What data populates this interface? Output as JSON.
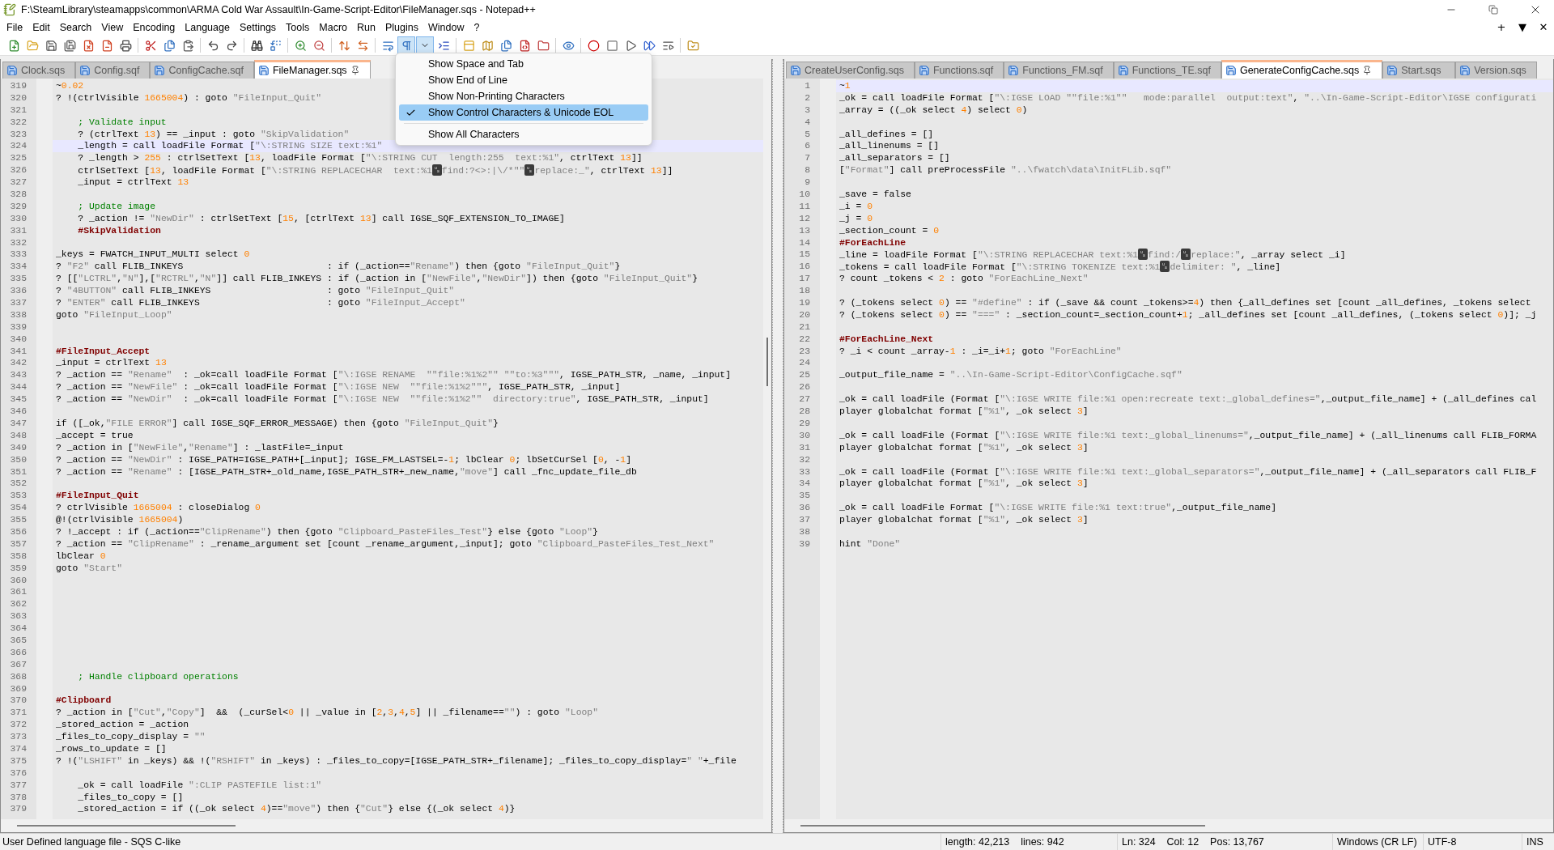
{
  "window": {
    "title": "F:\\SteamLibrary\\steamapps\\common\\ARMA Cold War Assault\\In-Game-Script-Editor\\FileManager.sqs - Notepad++"
  },
  "menu_bar": {
    "items": [
      "File",
      "Edit",
      "Search",
      "View",
      "Encoding",
      "Language",
      "Settings",
      "Tools",
      "Macro",
      "Run",
      "Plugins",
      "Window",
      "?"
    ],
    "doc_controls": [
      "+",
      "▼",
      "✕"
    ]
  },
  "toolbar": {
    "show_symbol_active": true
  },
  "dropdown": {
    "items": [
      {
        "kind": "item",
        "label": "Show Space and Tab",
        "checked": false,
        "selected": false
      },
      {
        "kind": "item",
        "label": "Show End of Line",
        "checked": false,
        "selected": false
      },
      {
        "kind": "item",
        "label": "Show Non-Printing Characters",
        "checked": false,
        "selected": false
      },
      {
        "kind": "item",
        "label": "Show Control Characters & Unicode EOL",
        "checked": true,
        "selected": true
      },
      {
        "kind": "separator"
      },
      {
        "kind": "item",
        "label": "Show All Characters",
        "checked": false,
        "selected": false
      }
    ]
  },
  "left_pane": {
    "tabs": [
      {
        "label": "Clock.sqs",
        "selected": false
      },
      {
        "label": "Config.sqf",
        "selected": false
      },
      {
        "label": "ConfigCache.sqf",
        "selected": false
      },
      {
        "label": "FileManager.sqs",
        "selected": true
      }
    ],
    "lines": [
      {
        "n": "319",
        "text": "~0.02",
        "current": false
      },
      {
        "n": "320",
        "text": "? !(ctrlVisible 1665004) : goto \"FileInput_Quit\"",
        "current": false
      },
      {
        "n": "321",
        "current": false
      },
      {
        "n": "322",
        "text": "    ; Validate input",
        "current": false
      },
      {
        "n": "323",
        "text": "    ? (ctrlText 13) == _input : goto \"SkipValidation\"",
        "current": false
      },
      {
        "n": "324",
        "text": "    _length = call loadFile Format [\"\\:STRING SIZE text:%1\"",
        "current": true
      },
      {
        "n": "325",
        "text": "    ? _length > 255 : ctrlSetText [13, loadFile Format [\"\\:STRING CUT  length:255  text:%1\", ctrlText 13]]",
        "current": false
      },
      {
        "n": "326",
        "text": "    ctrlSetText [13, loadFile Format [\"\\:STRING REPLACECHAR  text:%1␟find:?<>:|\\/*\"\"␟replace:_\", ctrlText 13]]",
        "current": false
      },
      {
        "n": "327",
        "text": "    _input = ctrlText 13",
        "current": false
      },
      {
        "n": "328",
        "current": false
      },
      {
        "n": "329",
        "text": "    ; Update image",
        "current": false
      },
      {
        "n": "330",
        "text": "    ? _action != \"NewDir\" : ctrlSetText [15, [ctrlText 13] call IGSE_SQF_EXTENSION_TO_IMAGE]",
        "current": false
      },
      {
        "n": "331",
        "text": "    #SkipValidation",
        "current": false
      },
      {
        "n": "332",
        "current": false
      },
      {
        "n": "333",
        "text": "_keys = FWATCH_INPUT_MULTI select 0",
        "current": false
      },
      {
        "n": "334",
        "text": "? \"F2\" call FLIB_INKEYS                          : if (_action==\"Rename\") then {goto \"FileInput_Quit\"}",
        "current": false
      },
      {
        "n": "335",
        "text": "? [[\"LCTRL\",\"N\"],[\"RCTRL\",\"N\"]] call FLIB_INKEYS : if (_action in [\"NewFile\",\"NewDir\"]) then {goto \"FileInput_Quit\"}",
        "current": false
      },
      {
        "n": "336",
        "text": "? \"4BUTTON\" call FLIB_INKEYS                     : goto \"FileInput_Quit\"",
        "current": false
      },
      {
        "n": "337",
        "text": "? \"ENTER\" call FLIB_INKEYS                       : goto \"FileInput_Accept\"",
        "current": false
      },
      {
        "n": "338",
        "text": "goto \"FileInput_Loop\"",
        "current": false
      },
      {
        "n": "339",
        "current": false
      },
      {
        "n": "340",
        "current": false
      },
      {
        "n": "341",
        "text": "#FileInput_Accept",
        "current": false
      },
      {
        "n": "342",
        "text": "_input = ctrlText 13",
        "current": false
      },
      {
        "n": "343",
        "text": "? _action == \"Rename\"  : _ok=call loadFile Format [\"\\:IGSE RENAME  \"\"file:%1%2\"\" \"\"to:%3\"\"\", IGSE_PATH_STR, _name, _input]",
        "current": false
      },
      {
        "n": "344",
        "text": "? _action == \"NewFile\" : _ok=call loadFile Format [\"\\:IGSE NEW  \"\"file:%1%2\"\"\", IGSE_PATH_STR, _input]",
        "current": false
      },
      {
        "n": "345",
        "text": "? _action == \"NewDir\"  : _ok=call loadFile Format [\"\\:IGSE NEW  \"\"file:%1%2\"\"  directory:true\", IGSE_PATH_STR, _input]",
        "current": false
      },
      {
        "n": "346",
        "current": false
      },
      {
        "n": "347",
        "text": "if ([_ok,\"FILE ERROR\"] call IGSE_SQF_ERROR_MESSAGE) then {goto \"FileInput_Quit\"}",
        "current": false
      },
      {
        "n": "348",
        "text": "_accept = true",
        "current": false
      },
      {
        "n": "349",
        "text": "? _action in [\"NewFile\",\"Rename\"] : _lastFile=_input",
        "current": false
      },
      {
        "n": "350",
        "text": "? _action == \"NewDir\" : IGSE_PATH=IGSE_PATH+[_input]; IGSE_FM_LASTSEL=-1; lbClear 0; lbSetCurSel [0, -1]",
        "current": false
      },
      {
        "n": "351",
        "text": "? _action == \"Rename\" : [IGSE_PATH_STR+_old_name,IGSE_PATH_STR+_new_name,\"move\"] call _fnc_update_file_db",
        "current": false
      },
      {
        "n": "352",
        "current": false
      },
      {
        "n": "353",
        "text": "#FileInput_Quit",
        "current": false
      },
      {
        "n": "354",
        "text": "? ctrlVisible 1665004 : closeDialog 0",
        "current": false
      },
      {
        "n": "355",
        "text": "@!(ctrlVisible 1665004)",
        "current": false
      },
      {
        "n": "356",
        "text": "? !_accept : if (_action==\"ClipRename\") then {goto \"Clipboard_PasteFiles_Test\"} else {goto \"Loop\"}",
        "current": false
      },
      {
        "n": "357",
        "text": "? _action == \"ClipRename\" : _rename_argument set [count _rename_argument,_input]; goto \"Clipboard_PasteFiles_Test_Next\"",
        "current": false
      },
      {
        "n": "358",
        "text": "lbClear 0",
        "current": false
      },
      {
        "n": "359",
        "text": "goto \"Start\"",
        "current": false
      },
      {
        "n": "360",
        "current": false
      },
      {
        "n": "361",
        "current": false
      },
      {
        "n": "362",
        "current": false
      },
      {
        "n": "363",
        "current": false
      },
      {
        "n": "364",
        "current": false
      },
      {
        "n": "365",
        "current": false
      },
      {
        "n": "366",
        "current": false
      },
      {
        "n": "367",
        "current": false
      },
      {
        "n": "368",
        "text": "    ; Handle clipboard operations",
        "current": false
      },
      {
        "n": "369",
        "current": false
      },
      {
        "n": "370",
        "text": "#Clipboard",
        "current": false
      },
      {
        "n": "371",
        "text": "? _action in [\"Cut\",\"Copy\"]  &&  (_curSel<0 || _value in [2,3,4,5] || _filename==\"\") : goto \"Loop\"",
        "current": false
      },
      {
        "n": "372",
        "text": "_stored_action = _action",
        "current": false
      },
      {
        "n": "373",
        "text": "_files_to_copy_display = \"\"",
        "current": false
      },
      {
        "n": "374",
        "text": "_rows_to_update = []",
        "current": false
      },
      {
        "n": "375",
        "text": "? !(\"LSHIFT\" in _keys) && !(\"RSHIFT\" in _keys) : _files_to_copy=[IGSE_PATH_STR+_filename]; _files_to_copy_display=\" \"+_file",
        "current": false
      },
      {
        "n": "376",
        "current": false
      },
      {
        "n": "377",
        "text": "    _ok = call loadFile \":CLIP PASTEFILE list:1\"",
        "current": false
      },
      {
        "n": "378",
        "text": "    _files_to_copy = []",
        "current": false
      },
      {
        "n": "379",
        "text": "    _stored_action = if ((_ok select 4)==\"move\") then {\"Cut\"} else {(_ok select 4)}",
        "current": false
      }
    ]
  },
  "right_pane": {
    "tabs": [
      {
        "label": "CreateUserConfig.sqs",
        "selected": false
      },
      {
        "label": "Functions.sqf",
        "selected": false
      },
      {
        "label": "Functions_FM.sqf",
        "selected": false
      },
      {
        "label": "Functions_TE.sqf",
        "selected": false
      },
      {
        "label": "GenerateConfigCache.sqs",
        "selected": true
      },
      {
        "label": "Start.sqs",
        "selected": false
      },
      {
        "label": "Version.sqs",
        "selected": false
      }
    ],
    "lines": [
      {
        "n": "1",
        "text": "~1",
        "current": true
      },
      {
        "n": "2",
        "text": "_ok = call loadFile Format [\"\\:IGSE LOAD \"\"file:%1\"\"   mode:parallel  output:text\", \"..\\In-Game-Script-Editor\\IGSE configurati",
        "current": false
      },
      {
        "n": "3",
        "text": "_array = ((_ok select 4) select 0)",
        "current": false
      },
      {
        "n": "4",
        "current": false
      },
      {
        "n": "5",
        "text": "_all_defines = []",
        "current": false
      },
      {
        "n": "6",
        "text": "_all_linenums = []",
        "current": false
      },
      {
        "n": "7",
        "text": "_all_separators = []",
        "current": false
      },
      {
        "n": "8",
        "text": "[\"Format\"] call preProcessFile \"..\\fwatch\\data\\InitFLib.sqf\"",
        "current": false
      },
      {
        "n": "9",
        "current": false
      },
      {
        "n": "10",
        "text": "_save = false",
        "current": false
      },
      {
        "n": "11",
        "text": "_i = 0",
        "current": false
      },
      {
        "n": "12",
        "text": "_j = 0",
        "current": false
      },
      {
        "n": "13",
        "text": "_section_count = 0",
        "current": false
      },
      {
        "n": "14",
        "text": "#ForEachLine",
        "current": false
      },
      {
        "n": "15",
        "text": "_line = loadFile Format [\"\\:STRING REPLACECHAR text:%1␟find:/␟replace:\", _array select _i]",
        "current": false
      },
      {
        "n": "16",
        "text": "_tokens = call loadFile Format [\"\\:STRING TOKENIZE text:%1␟delimiter: \", _line]",
        "current": false
      },
      {
        "n": "17",
        "text": "? count _tokens < 2 : goto \"ForEachLine_Next\"",
        "current": false
      },
      {
        "n": "18",
        "current": false
      },
      {
        "n": "19",
        "text": "? (_tokens select 0) == \"#define\" : if (_save && count _tokens>=4) then {_all_defines set [count _all_defines, _tokens select",
        "current": false
      },
      {
        "n": "20",
        "text": "? (_tokens select 0) == \"===\" : _section_count=_section_count+1; _all_defines set [count _all_defines, (_tokens select 0)]; _j",
        "current": false
      },
      {
        "n": "21",
        "current": false
      },
      {
        "n": "22",
        "text": "#ForEachLine_Next",
        "current": false
      },
      {
        "n": "23",
        "text": "? _i < count _array-1 : _i=_i+1; goto \"ForEachLine\"",
        "current": false
      },
      {
        "n": "24",
        "current": false
      },
      {
        "n": "25",
        "text": "_output_file_name = \"..\\In-Game-Script-Editor\\ConfigCache.sqf\"",
        "current": false
      },
      {
        "n": "26",
        "current": false
      },
      {
        "n": "27",
        "text": "_ok = call loadFile (Format [\"\\:IGSE WRITE file:%1 open:recreate text:_global_defines=\",_output_file_name] + (_all_defines cal",
        "current": false
      },
      {
        "n": "28",
        "text": "player globalchat format [\"%1\", _ok select 3]",
        "current": false
      },
      {
        "n": "29",
        "current": false
      },
      {
        "n": "30",
        "text": "_ok = call loadFile (Format [\"\\:IGSE WRITE file:%1 text:_global_linenums=\",_output_file_name] + (_all_linenums call FLIB_FORMA",
        "current": false
      },
      {
        "n": "31",
        "text": "player globalchat format [\"%1\", _ok select 3]",
        "current": false
      },
      {
        "n": "32",
        "current": false
      },
      {
        "n": "33",
        "text": "_ok = call loadFile (Format [\"\\:IGSE WRITE file:%1 text:_global_separators=\",_output_file_name] + (_all_separators call FLIB_F",
        "current": false
      },
      {
        "n": "34",
        "text": "player globalchat format [\"%1\", _ok select 3]",
        "current": false
      },
      {
        "n": "35",
        "current": false
      },
      {
        "n": "36",
        "text": "_ok = call loadFile Format [\"\\:IGSE WRITE file:%1 text:true\",_output_file_name]",
        "current": false
      },
      {
        "n": "37",
        "text": "player globalchat format [\"%1\", _ok select 3]",
        "current": false
      },
      {
        "n": "38",
        "current": false
      },
      {
        "n": "39",
        "text": "hint \"Done\"",
        "current": false
      }
    ]
  },
  "status_bar": {
    "cells": [
      "User Defined language file - SQS C-like",
      "length: 42,213    lines: 942",
      "Ln: 324    Col: 12    Pos: 13,767",
      "Windows (CR LF)",
      "UTF-8",
      "INS"
    ]
  }
}
